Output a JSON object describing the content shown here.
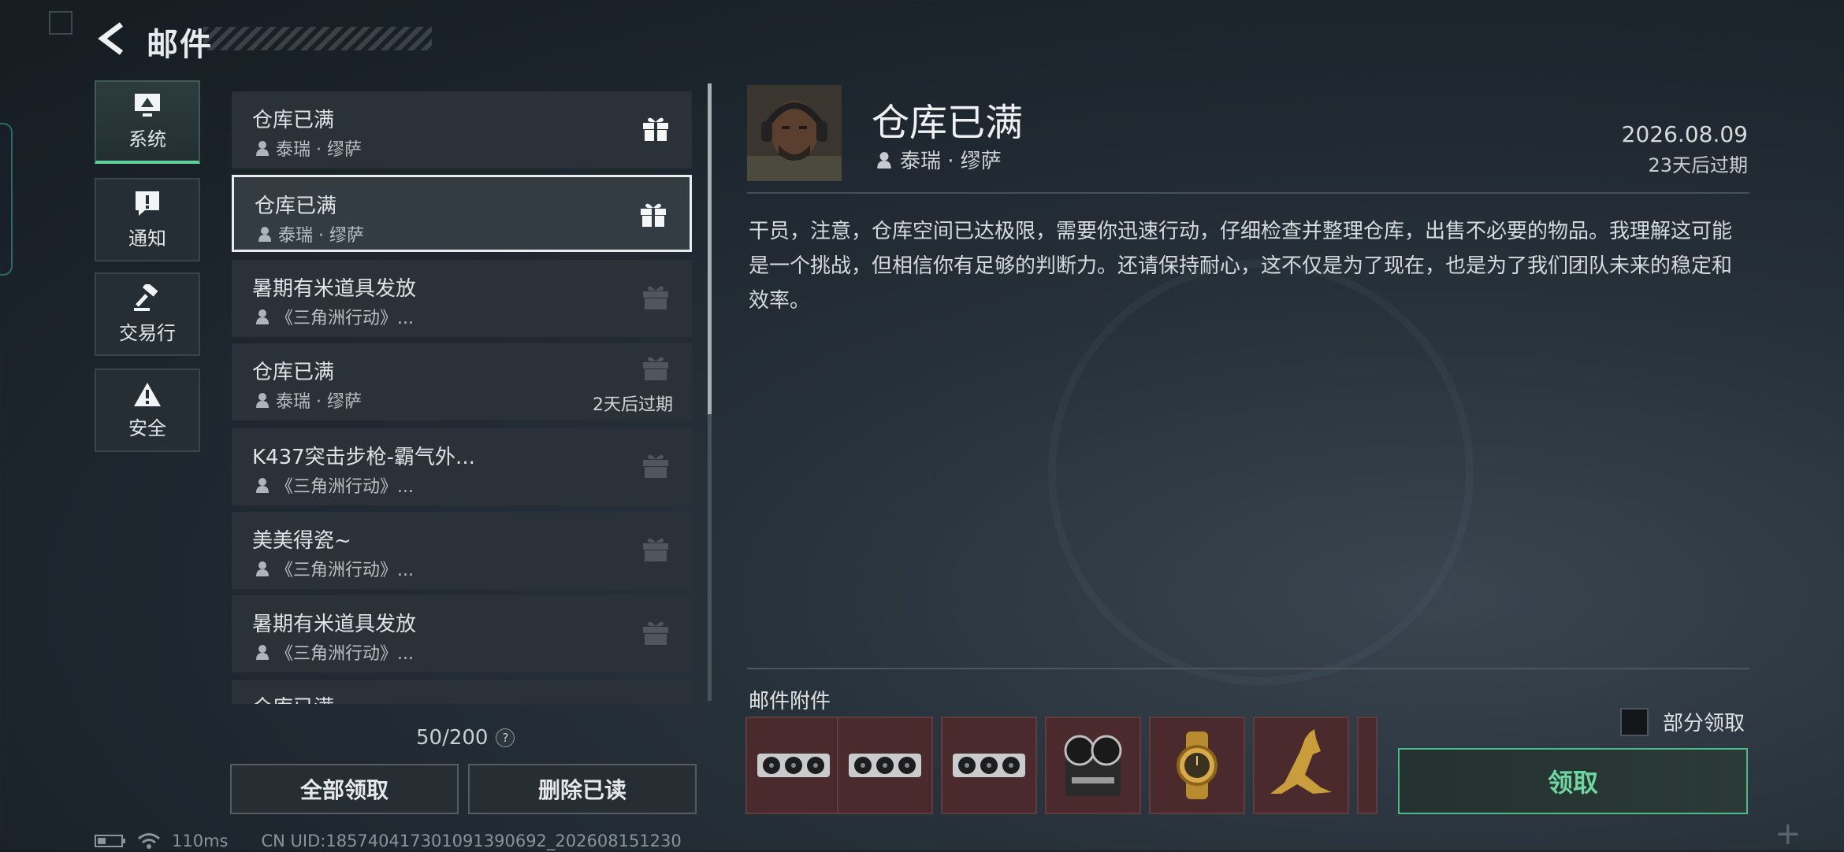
{
  "header": {
    "title": "邮件"
  },
  "categories": [
    {
      "label": "系统",
      "icon": "monitor-icon"
    },
    {
      "label": "通知",
      "icon": "alert-message-icon"
    },
    {
      "label": "交易行",
      "icon": "gavel-icon"
    },
    {
      "label": "安全",
      "icon": "warning-triangle-icon"
    }
  ],
  "mail_list": [
    {
      "title": "仓库已满",
      "sender": "泰瑞 · 缪萨",
      "gift": "gift-icon",
      "gift_active": true,
      "expiry": ""
    },
    {
      "title": "仓库已满",
      "sender": "泰瑞 · 缪萨",
      "gift": "gift-icon",
      "gift_active": true,
      "expiry": "",
      "selected": true
    },
    {
      "title": "暑期有米道具发放",
      "sender": "《三角洲行动》...",
      "gift": "gift-icon",
      "gift_active": false,
      "expiry": ""
    },
    {
      "title": "仓库已满",
      "sender": "泰瑞 · 缪萨",
      "gift": "gift-icon",
      "gift_active": false,
      "expiry": "2天后过期"
    },
    {
      "title": "K437突击步枪-霸气外...",
      "sender": "《三角洲行动》...",
      "gift": "gift-icon",
      "gift_active": false,
      "expiry": ""
    },
    {
      "title": "美美得瓷~",
      "sender": "《三角洲行动》...",
      "gift": "gift-icon",
      "gift_active": false,
      "expiry": ""
    },
    {
      "title": "暑期有米道具发放",
      "sender": "《三角洲行动》...",
      "gift": "gift-icon",
      "gift_active": false,
      "expiry": ""
    },
    {
      "title": "仓库已满",
      "sender": "",
      "gift": "gift-icon",
      "gift_active": false,
      "expiry": ""
    }
  ],
  "mail_count": "50/200",
  "buttons": {
    "claim_all": "全部领取",
    "delete_read": "删除已读",
    "claim": "领取"
  },
  "status_bar": {
    "ping": "110ms",
    "uid": "CN UID:185740417301091390692_202608151230"
  },
  "detail": {
    "title": "仓库已满",
    "sender": "泰瑞 · 缪萨",
    "date": "2026.08.09",
    "expiry": "23天后过期",
    "body": "干员，注意，仓库空间已达极限，需要你迅速行动，仔细检查并整理仓库，出售不必要的物品。我理解这可能是一个挑战，但相信你有足够的判断力。还请保持耐心，这不仅是为了现在，也是为了我们团队未来的稳定和效率。",
    "attachments_title": "邮件附件",
    "attachments": [
      "graphics-card",
      "graphics-card",
      "graphics-card",
      "tape-recorder",
      "gold-watch",
      "golden-horse-statue",
      "partial-item"
    ],
    "partial_claim_label": "部分领取"
  },
  "colors": {
    "accent_green": "#5fd39a",
    "attachment_bg": "#4a2a2c"
  }
}
